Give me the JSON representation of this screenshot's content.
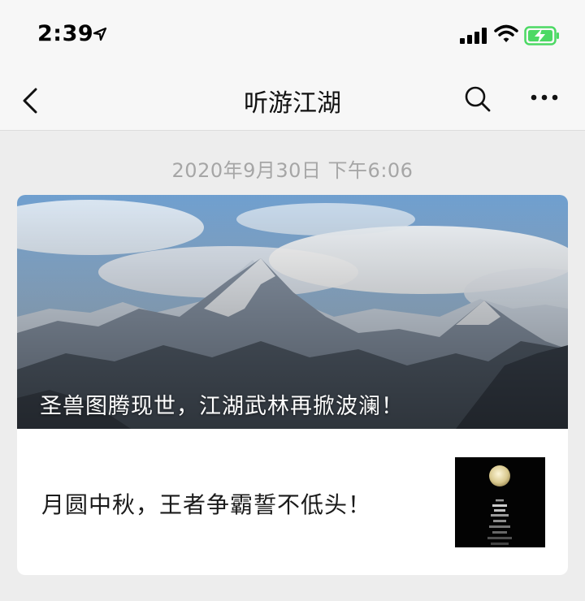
{
  "status_bar": {
    "time": "2:39"
  },
  "nav": {
    "title": "听游江湖"
  },
  "message": {
    "timestamp": "2020年9月30日 下午6:06",
    "articles": [
      {
        "title": "圣兽图腾现世，江湖武林再掀波澜！"
      },
      {
        "title": "月圆中秋，王者争霸誓不低头！"
      }
    ]
  },
  "colors": {
    "battery_green": "#4cd964",
    "background": "#ededed"
  }
}
